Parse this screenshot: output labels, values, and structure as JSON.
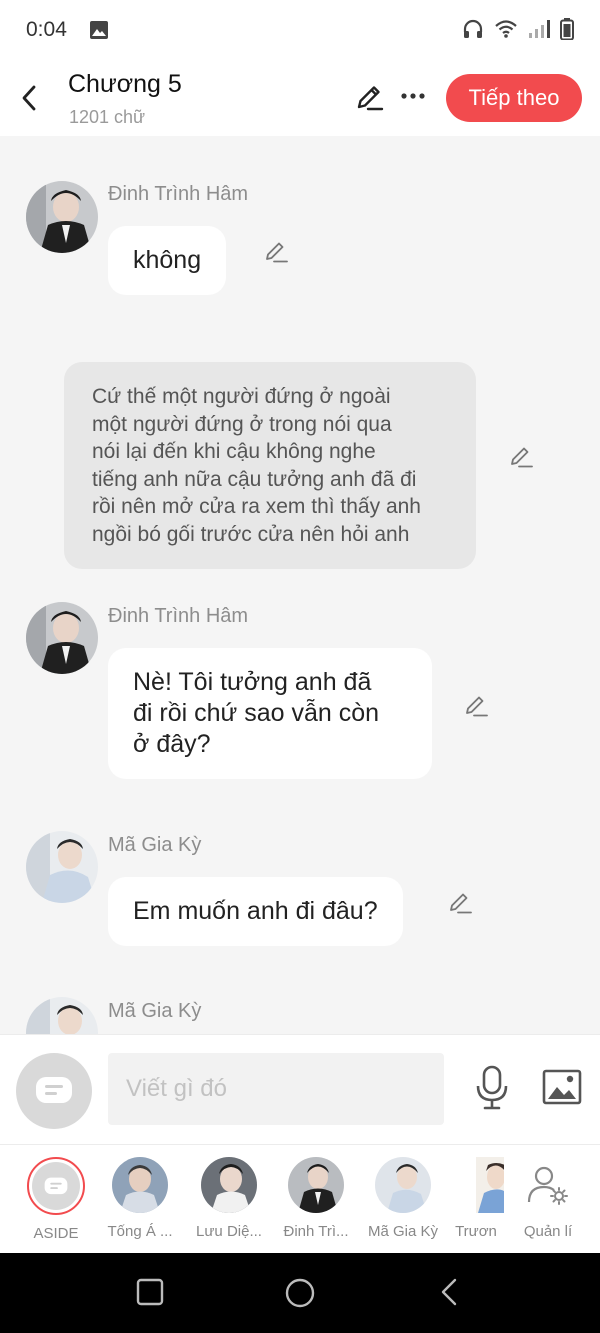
{
  "status_bar": {
    "time": "0:04",
    "left_icons": [
      "gallery-icon"
    ],
    "right_icons": [
      "headphones-icon",
      "wifi-icon",
      "signal-icon",
      "battery-icon"
    ]
  },
  "header": {
    "title": "Chương 5",
    "subtitle": "1201 chữ",
    "next_label": "Tiếp theo"
  },
  "messages": [
    {
      "type": "dialogue",
      "sender": "Đinh Trình Hâm",
      "avatar": "dark-suit-portrait",
      "lines": [
        "không"
      ]
    },
    {
      "type": "narration",
      "lines": [
        "Cứ thế một người đứng ở ngoài",
        "một người đứng ở trong nói qua",
        "nói lại đến khi cậu không nghe",
        "tiếng anh nữa cậu tưởng anh đã đi",
        "rồi nên mở cửa ra xem thì thấy anh",
        "ngồi bó gối trước cửa nên hỏi anh"
      ]
    },
    {
      "type": "dialogue",
      "sender": "Đinh Trình Hâm",
      "avatar": "dark-suit-portrait",
      "lines": [
        "Nè! Tôi tưởng anh đã",
        "đi rồi chứ sao vẫn còn",
        "ở đây?"
      ]
    },
    {
      "type": "dialogue",
      "sender": "Mã Gia Kỳ",
      "avatar": "light-shirt-portrait",
      "lines": [
        "Em muốn anh đi đâu?"
      ]
    },
    {
      "type": "dialogue",
      "sender": "Mã Gia Kỳ",
      "avatar": "light-shirt-portrait",
      "lines": []
    }
  ],
  "input_bar": {
    "placeholder": "Viết gì đó",
    "icons": [
      "aside-bubble-icon",
      "microphone-icon",
      "image-icon"
    ]
  },
  "characters": [
    {
      "label": "ASIDE",
      "selected": true
    },
    {
      "label": "Tống Á ..."
    },
    {
      "label": "Lưu Diệ..."
    },
    {
      "label": "Đinh Trì..."
    },
    {
      "label": "Mã Gia Kỳ"
    },
    {
      "label": "Trươn"
    },
    {
      "label": "Quản lí"
    }
  ],
  "nav_bar": {
    "icons": [
      "recent-apps-icon",
      "home-icon",
      "back-icon"
    ]
  },
  "colors": {
    "accent": "#f24b4e",
    "chat_background": "#f5f5f5",
    "narration_background": "#e7e7e7",
    "secondary_text": "#8d8d8d"
  }
}
